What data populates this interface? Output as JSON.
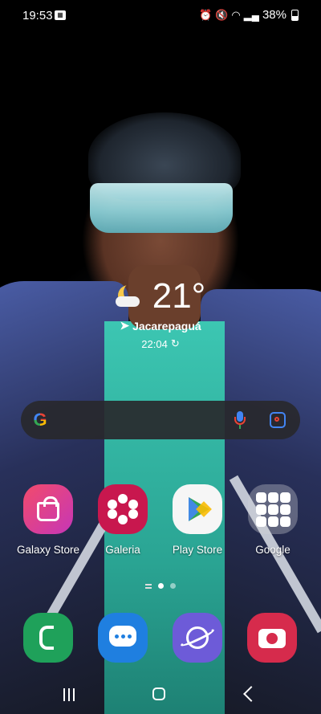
{
  "status_bar": {
    "time": "19:53",
    "battery": "38%",
    "icons": [
      "notification-icon",
      "alarm-icon",
      "mute-icon",
      "wifi-icon",
      "signal-icon",
      "battery-icon"
    ]
  },
  "weather": {
    "temperature": "21°",
    "location": "Jacarepaguá",
    "updated_time": "22:04",
    "condition_icon": "moon-cloud-icon"
  },
  "search": {
    "icons": [
      "google-logo-icon",
      "mic-icon",
      "lens-icon"
    ]
  },
  "apps": [
    {
      "label": "Galaxy Store",
      "icon": "shopping-bag-icon"
    },
    {
      "label": "Galeria",
      "icon": "flower-icon"
    },
    {
      "label": "Play Store",
      "icon": "play-triangle-icon"
    },
    {
      "label": "Google",
      "icon": "folder-icon"
    }
  ],
  "dock": [
    {
      "name": "Phone",
      "icon": "phone-icon"
    },
    {
      "name": "Messages",
      "icon": "message-icon"
    },
    {
      "name": "Internet",
      "icon": "planet-icon"
    },
    {
      "name": "Camera",
      "icon": "camera-icon"
    }
  ],
  "colors": {
    "galaxy_store": "#e4418f",
    "galeria": "#c8174e",
    "phone": "#1fa15a",
    "messages": "#1f7fe0",
    "internet": "#6d5bd8",
    "camera": "#d62b4c"
  }
}
